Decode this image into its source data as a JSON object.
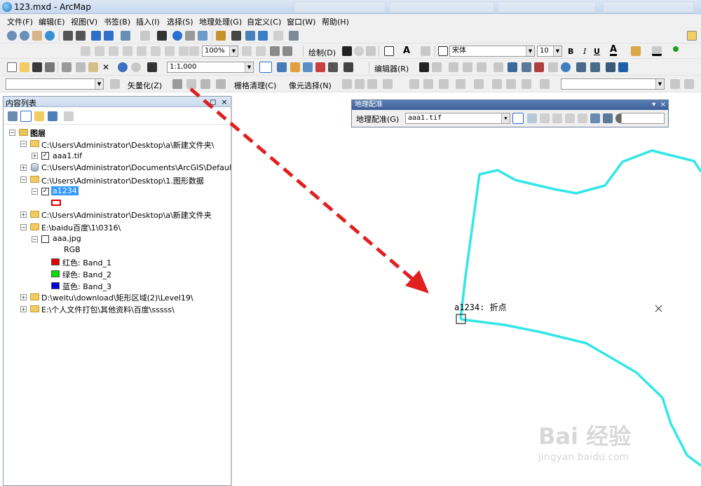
{
  "window": {
    "title": "123.mxd - ArcMap"
  },
  "menubar": {
    "items": [
      "文件(F)",
      "编辑(E)",
      "视图(V)",
      "书签(B)",
      "插入(I)",
      "选择(S)",
      "地理处理(G)",
      "自定义(C)",
      "窗口(W)",
      "帮助(H)"
    ]
  },
  "toolbar": {
    "zoom_percent": "100%",
    "draw_label": "绘制(D)",
    "font_name": "宋体",
    "font_size": "10",
    "bold": "B",
    "italic": "I",
    "underline": "U",
    "scale": "1:1,000",
    "editor_label": "编辑器(R)",
    "vectorize_label": "矢量化(Z)",
    "raster_cleanup_label": "栅格清理(C)",
    "pixel_select_label": "像元选择(N)"
  },
  "toc": {
    "title": "内容列表",
    "pin": "◻",
    "close": "×",
    "layers_root": "图层",
    "rows": [
      {
        "text": "C:\\Users\\Administrator\\Desktop\\a\\新建文件夹\\"
      },
      {
        "text": "aaa1.tif"
      },
      {
        "text": "C:\\Users\\Administrator\\Documents\\ArcGIS\\Default.gdb"
      },
      {
        "text": "C:\\Users\\Administrator\\Desktop\\1.图形数据"
      },
      {
        "text": "a1234"
      },
      {
        "text": "C:\\Users\\Administrator\\Desktop\\a\\新建文件夹"
      },
      {
        "text": "E:\\baidu百度\\1\\0316\\"
      },
      {
        "text": "aaa.jpg"
      },
      {
        "text": "RGB"
      },
      {
        "text": "红色:   Band_1"
      },
      {
        "text": "绿色: Band_2"
      },
      {
        "text": "蓝色:   Band_3"
      },
      {
        "text": "D:\\weitu\\download\\矩形区域(2)\\Level19\\"
      },
      {
        "text": "E:\\个人文件打包\\其他资料\\百度\\sssss\\"
      }
    ],
    "band_colors": [
      "#e00000",
      "#00e000",
      "#0000e0"
    ]
  },
  "georef": {
    "title": "地理配准",
    "menu_label": "地理配准(G)",
    "layer_value": "aaa1.tif",
    "close": "×",
    "dropdown": "▾"
  },
  "map": {
    "snap_label": "a1234: 折点",
    "line_color": "#33e6e6",
    "arrow_color": "#e02020"
  },
  "watermark": {
    "brand": "Bai 经验",
    "url": "jingyan.baidu.com"
  }
}
